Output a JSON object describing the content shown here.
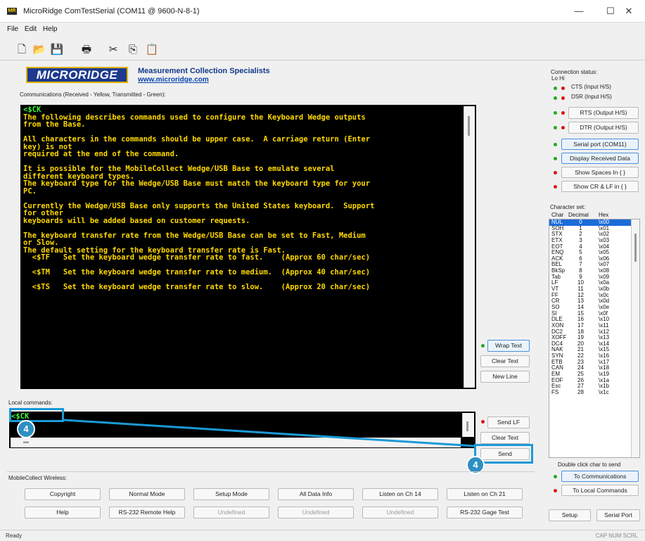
{
  "window": {
    "title": "MicroRidge ComTestSerial (COM11 @ 9600-N-8-1)",
    "icon_text": "MR",
    "minimize": "—",
    "maximize": "☐",
    "close": "✕"
  },
  "menu": [
    "File",
    "Edit",
    "Help"
  ],
  "toolbar": {
    "icons": [
      "new-file-icon",
      "open-folder-icon",
      "save-icon",
      "print-icon",
      "cut-icon",
      "copy-icon",
      "paste-icon"
    ],
    "glyphs": [
      "🗋",
      "📂",
      "💾",
      "🖶",
      "✂",
      "⎘",
      "📋"
    ]
  },
  "logo": {
    "text": "MICRORIDGE",
    "tagline": "Measurement Collection Specialists",
    "url": "www.microridge.com"
  },
  "comm_label": "Communications (Received - Yellow, Transmitted - Green):",
  "terminal_lines": [
    {
      "text": "<$CK",
      "color": "green"
    },
    {
      "text": "The following describes commands used to configure the Keyboard Wedge outputs",
      "color": "yellow"
    },
    {
      "text": "from the Base.",
      "color": "yellow"
    },
    {
      "text": "",
      "color": "yellow"
    },
    {
      "text": "All characters in the commands should be upper case.  A carriage return (Enter",
      "color": "yellow"
    },
    {
      "text": "key) is not",
      "color": "yellow"
    },
    {
      "text": "required at the end of the command.",
      "color": "yellow"
    },
    {
      "text": "",
      "color": "yellow"
    },
    {
      "text": "It is possible for the MobileCollect Wedge/USB Base to emulate several",
      "color": "yellow"
    },
    {
      "text": "different keyboard types.",
      "color": "yellow"
    },
    {
      "text": "The keyboard type for the Wedge/USB Base must match the keyboard type for your",
      "color": "yellow"
    },
    {
      "text": "PC.",
      "color": "yellow"
    },
    {
      "text": "",
      "color": "yellow"
    },
    {
      "text": "Currently the Wedge/USB Base only supports the United States keyboard.  Support",
      "color": "yellow"
    },
    {
      "text": "for other",
      "color": "yellow"
    },
    {
      "text": "keyboards will be added based on customer requests.",
      "color": "yellow"
    },
    {
      "text": "",
      "color": "yellow"
    },
    {
      "text": "The keyboard transfer rate from the Wedge/USB Base can be set to Fast, Medium",
      "color": "yellow"
    },
    {
      "text": "or Slow.",
      "color": "yellow"
    },
    {
      "text": "The default setting for the keyboard transfer rate is Fast.",
      "color": "yellow"
    },
    {
      "text": "  <$TF   Set the keyboard wedge transfer rate to fast.    (Approx 60 char/sec)",
      "color": "yellow"
    },
    {
      "text": "",
      "color": "yellow"
    },
    {
      "text": "  <$TM   Set the keyboard wedge transfer rate to medium.  (Approx 40 char/sec)",
      "color": "yellow"
    },
    {
      "text": "",
      "color": "yellow"
    },
    {
      "text": "  <$TS   Set the keyboard wedge transfer rate to slow.    (Approx 20 char/sec)",
      "color": "yellow"
    }
  ],
  "term_buttons": {
    "wrap": "Wrap Text",
    "clear": "Clear Text",
    "newline": "New Line"
  },
  "local": {
    "label": "Local commands:",
    "value": "<$CK",
    "send_lf": "Send LF",
    "clear": "Clear Text",
    "send": "Send",
    "hscroll": "▬"
  },
  "callouts": {
    "a": "4",
    "b": "4"
  },
  "wireless": {
    "label": "MobileCollect Wireless:",
    "row1": [
      "Copyright",
      "Normal Mode",
      "Setup Mode",
      "All Data Info",
      "Listen on Ch 14",
      "Listen on Ch 21"
    ],
    "row2": [
      "Help",
      "RS-232 Remote Help",
      "Undefined",
      "Undefined",
      "Undefined",
      "RS-232 Gage Test"
    ]
  },
  "connection": {
    "label": "Connection status:",
    "lohi": "Lo Hi",
    "cts": "CTS (Input H/S)",
    "dsr": "DSR (Input H/S)",
    "rts": "RTS (Output H/S)",
    "dtr": "DTR (Output H/S)"
  },
  "side_buttons": {
    "serial": "Serial port  (COM11)",
    "display": "Display Received Data",
    "spaces": "Show Spaces In { }",
    "crlf": "Show CR & LF in { }"
  },
  "charset": {
    "label": "Character set:",
    "headers": [
      "Char",
      "Decimal",
      "Hex"
    ],
    "rows": [
      [
        "NUL",
        "0",
        "\\x00"
      ],
      [
        "SOH",
        "1",
        "\\x01"
      ],
      [
        "STX",
        "2",
        "\\x02"
      ],
      [
        "ETX",
        "3",
        "\\x03"
      ],
      [
        "EOT",
        "4",
        "\\x04"
      ],
      [
        "ENQ",
        "5",
        "\\x05"
      ],
      [
        "ACK",
        "6",
        "\\x06"
      ],
      [
        "BEL",
        "7",
        "\\x07"
      ],
      [
        "BkSp",
        "8",
        "\\x08"
      ],
      [
        "Tab",
        "9",
        "\\x09"
      ],
      [
        "LF",
        "10",
        "\\x0a"
      ],
      [
        "VT",
        "11",
        "\\x0b"
      ],
      [
        "FF",
        "12",
        "\\x0c"
      ],
      [
        "CR",
        "13",
        "\\x0d"
      ],
      [
        "SO",
        "14",
        "\\x0e"
      ],
      [
        "SI",
        "15",
        "\\x0f"
      ],
      [
        "DLE",
        "16",
        "\\x10"
      ],
      [
        "XON",
        "17",
        "\\x11"
      ],
      [
        "DC2",
        "18",
        "\\x12"
      ],
      [
        "XOFF",
        "19",
        "\\x13"
      ],
      [
        "DC4",
        "20",
        "\\x14"
      ],
      [
        "NAK",
        "21",
        "\\x15"
      ],
      [
        "SYN",
        "22",
        "\\x16"
      ],
      [
        "ETB",
        "23",
        "\\x17"
      ],
      [
        "CAN",
        "24",
        "\\x18"
      ],
      [
        "EM",
        "25",
        "\\x19"
      ],
      [
        "EOF",
        "26",
        "\\x1a"
      ],
      [
        "Esc",
        "27",
        "\\x1b"
      ],
      [
        "FS",
        "28",
        "\\x1c"
      ]
    ],
    "hint": "Double click char to send",
    "to_comm": "To Communications",
    "to_local": "To Local Commands"
  },
  "bottom_buttons": {
    "setup": "Setup",
    "serial": "Serial Port"
  },
  "status": {
    "left": "Ready",
    "right": "CAP NUM SCRL"
  }
}
